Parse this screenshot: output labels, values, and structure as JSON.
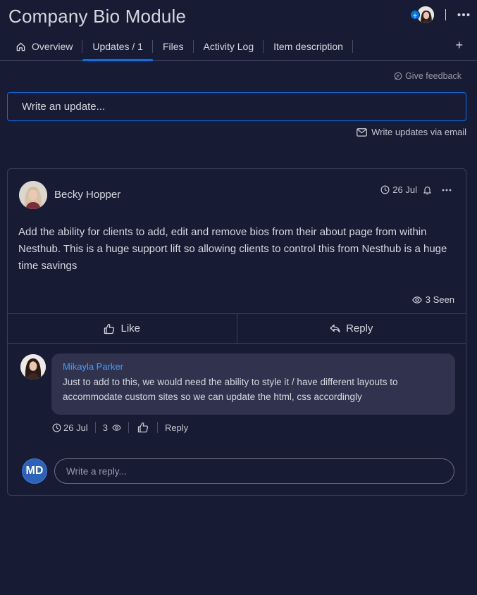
{
  "header": {
    "title": "Company Bio Module",
    "add_subscriber_icon": "plus-circle-icon",
    "more_icon": "more-horizontal-icon"
  },
  "tabs": [
    {
      "label": "Overview",
      "icon": "home-icon",
      "active": false
    },
    {
      "label": "Updates / 1",
      "active": true
    },
    {
      "label": "Files",
      "active": false
    },
    {
      "label": "Activity Log",
      "active": false
    },
    {
      "label": "Item description",
      "active": false
    }
  ],
  "tabs_add_label": "+",
  "feedback": {
    "label": "Give feedback"
  },
  "update_input": {
    "placeholder": "Write an update..."
  },
  "email_updates": {
    "label": "Write updates via email"
  },
  "post": {
    "author": "Becky Hopper",
    "date": "26 Jul",
    "body": "Add the ability for clients to add, edit and remove bios from their about page from within Nesthub. This is a huge support lift so allowing clients to control this from Nesthub is a huge time savings",
    "seen_label": "3 Seen",
    "like_label": "Like",
    "reply_label": "Reply"
  },
  "reply": {
    "author": "Mikayla Parker",
    "text": "Just to add to this, we would need the ability to style it / have different layouts to accommodate custom sites so we can update the html, css accordingly",
    "date": "26 Jul",
    "views": "3",
    "reply_label": "Reply"
  },
  "composer": {
    "initials": "MD",
    "placeholder": "Write a reply..."
  },
  "colors": {
    "background": "#181b34",
    "accent": "#0073ea",
    "reply_author": "#4a9bff",
    "bubble": "#30324e"
  }
}
